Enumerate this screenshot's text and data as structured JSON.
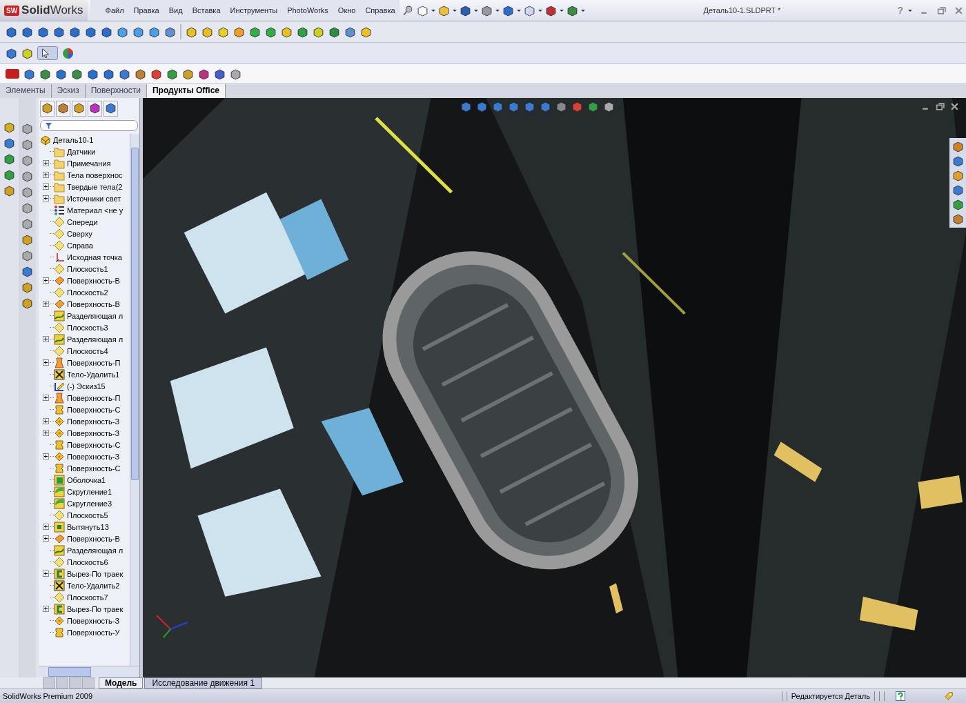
{
  "app": {
    "logo_badge": "SW",
    "logo_text": "**Solid**Works"
  },
  "menu": [
    "Файл",
    "Правка",
    "Вид",
    "Вставка",
    "Инструменты",
    "PhotoWorks",
    "Окно",
    "Справка"
  ],
  "window": {
    "title": "Деталь10-1.SLDPRT *",
    "help_glyph": "?"
  },
  "command_tabs": [
    {
      "label": "Элементы",
      "selected": false
    },
    {
      "label": "Эскиз",
      "selected": false
    },
    {
      "label": "Поверхности",
      "selected": false
    },
    {
      "label": "Продукты Office",
      "selected": true
    }
  ],
  "feature_tree": {
    "root": {
      "label": "Деталь10-1",
      "kind": "part",
      "children": [
        {
          "label": "Датчики",
          "kind": "folder",
          "collapsed": false
        },
        {
          "label": "Примечания",
          "kind": "folder",
          "collapsed": true
        },
        {
          "label": "Тела поверхнос",
          "kind": "folder",
          "collapsed": true
        },
        {
          "label": "Твердые тела(2",
          "kind": "folder",
          "collapsed": true
        },
        {
          "label": "Источники свет",
          "kind": "folder",
          "collapsed": true
        },
        {
          "label": "Материал <не у",
          "kind": "material",
          "collapsed": false
        },
        {
          "label": "Спереди",
          "kind": "plane",
          "collapsed": false
        },
        {
          "label": "Сверху",
          "kind": "plane",
          "collapsed": false
        },
        {
          "label": "Справа",
          "kind": "plane",
          "collapsed": false
        },
        {
          "label": "Исходная точка",
          "kind": "origin",
          "collapsed": false
        },
        {
          "label": "Плоскость1",
          "kind": "plane",
          "collapsed": false
        },
        {
          "label": "Поверхность-В",
          "kind": "surface",
          "collapsed": true
        },
        {
          "label": "Плоскость2",
          "kind": "plane",
          "collapsed": false
        },
        {
          "label": "Поверхность-В",
          "kind": "surface",
          "collapsed": true
        },
        {
          "label": "Разделяющая л",
          "kind": "split",
          "collapsed": false
        },
        {
          "label": "Плоскость3",
          "kind": "plane",
          "collapsed": false
        },
        {
          "label": "Разделяющая л",
          "kind": "split",
          "collapsed": true
        },
        {
          "label": "Плоскость4",
          "kind": "plane",
          "collapsed": false
        },
        {
          "label": "Поверхность-П",
          "kind": "loft",
          "collapsed": true
        },
        {
          "label": "Тело-Удалить1",
          "kind": "delete",
          "collapsed": false
        },
        {
          "label": "(-) Эскиз15",
          "kind": "sketch",
          "collapsed": false
        },
        {
          "label": "Поверхность-П",
          "kind": "loft",
          "collapsed": true
        },
        {
          "label": "Поверхность-С",
          "kind": "knit",
          "collapsed": false
        },
        {
          "label": "Поверхность-З",
          "kind": "fill",
          "collapsed": true
        },
        {
          "label": "Поверхность-З",
          "kind": "fill",
          "collapsed": true
        },
        {
          "label": "Поверхность-С",
          "kind": "knit",
          "collapsed": false
        },
        {
          "label": "Поверхность-З",
          "kind": "fill",
          "collapsed": true
        },
        {
          "label": "Поверхность-С",
          "kind": "knit",
          "collapsed": false
        },
        {
          "label": "Оболочка1",
          "kind": "shell",
          "collapsed": false
        },
        {
          "label": "Скругление1",
          "kind": "fillet",
          "collapsed": false
        },
        {
          "label": "Скругление3",
          "kind": "fillet",
          "collapsed": false
        },
        {
          "label": "Плоскость5",
          "kind": "plane",
          "collapsed": false
        },
        {
          "label": "Вытянуть13",
          "kind": "extrude",
          "collapsed": true
        },
        {
          "label": "Поверхность-В",
          "kind": "surface",
          "collapsed": true
        },
        {
          "label": "Разделяющая л",
          "kind": "split",
          "collapsed": false
        },
        {
          "label": "Плоскость6",
          "kind": "plane",
          "collapsed": false
        },
        {
          "label": "Вырез-По траек",
          "kind": "cut",
          "collapsed": true
        },
        {
          "label": "Тело-Удалить2",
          "kind": "delete",
          "collapsed": false
        },
        {
          "label": "Плоскость7",
          "kind": "plane",
          "collapsed": false
        },
        {
          "label": "Вырез-По траек",
          "kind": "cut",
          "collapsed": true
        },
        {
          "label": "Поверхность-З",
          "kind": "fill",
          "collapsed": false
        },
        {
          "label": "Поверхность-У",
          "kind": "knit",
          "collapsed": false
        }
      ]
    }
  },
  "bottom_tabs": [
    {
      "label": "Модель",
      "selected": true
    },
    {
      "label": "Исследование движения 1",
      "selected": false
    }
  ],
  "status_bar": {
    "product": "SolidWorks Premium 2009",
    "mode": "Редактируется Деталь"
  }
}
